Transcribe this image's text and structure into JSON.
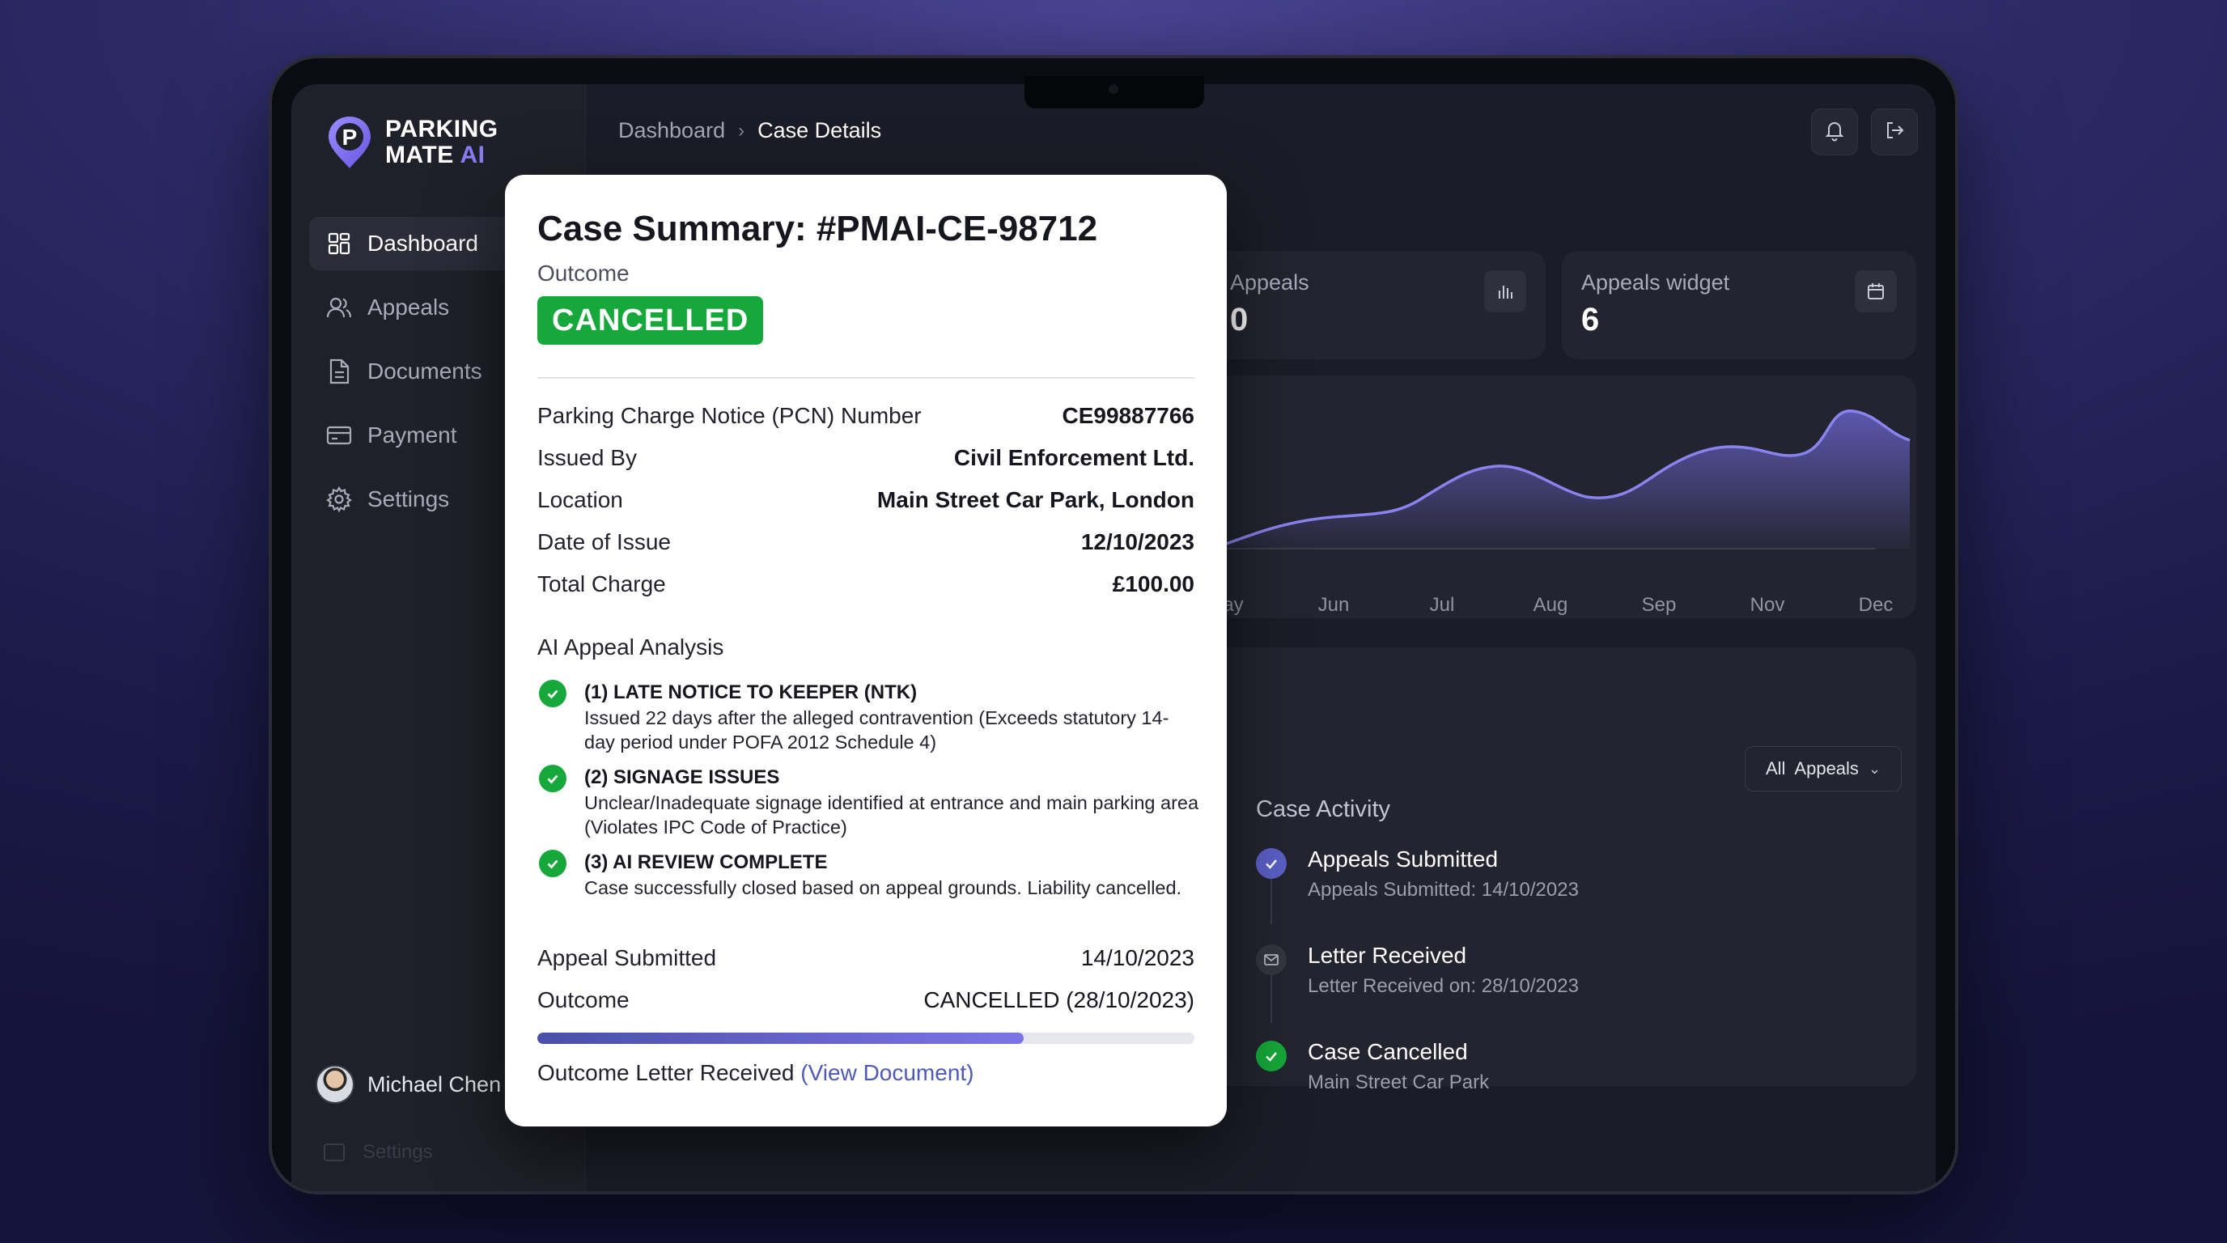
{
  "brand": {
    "line1": "PARKING",
    "line2": "MATE",
    "ai": "AI",
    "accent": "#8b7cf6"
  },
  "sidebar": {
    "items": [
      {
        "label": "Dashboard",
        "icon": "grid-icon",
        "active": true
      },
      {
        "label": "Appeals",
        "icon": "users-icon",
        "active": false
      },
      {
        "label": "Documents",
        "icon": "document-icon",
        "active": false
      },
      {
        "label": "Payment",
        "icon": "credit-card-icon",
        "active": false
      },
      {
        "label": "Settings",
        "icon": "gear-icon",
        "active": false
      }
    ],
    "user": {
      "name": "Michael Chen"
    },
    "ghost_item": "Settings"
  },
  "breadcrumb": {
    "root": "Dashboard",
    "current": "Case Details"
  },
  "topbar": {
    "bell_icon": "bell-icon",
    "logout_icon": "logout-icon"
  },
  "cards": {
    "appeals": {
      "label": "Appeals",
      "value": "0",
      "icon": "bar-chart-icon"
    },
    "widget": {
      "label": "Appeals widget",
      "value": "6",
      "icon": "calendar-icon"
    }
  },
  "chart_data": {
    "type": "area",
    "categories": [
      "May",
      "Jun",
      "Jul",
      "Aug",
      "Sep",
      "Nov",
      "Dec"
    ],
    "color": "#6f68d8"
  },
  "activity": {
    "filter_label": "All  Appeals",
    "title": "Case Activity",
    "items": [
      {
        "title": "Appeals Submitted",
        "sub": "Appeals Submitted: 14/10/2023",
        "icon": "check-icon",
        "color": "#5a5fc7"
      },
      {
        "title": "Letter Received",
        "sub": "Letter Received on: 28/10/2023",
        "icon": "mail-icon",
        "color": "#3a3b48"
      },
      {
        "title": "Case Cancelled",
        "sub": "Main Street Car Park",
        "icon": "check-icon",
        "color": "#16a83a"
      }
    ]
  },
  "modal": {
    "title": "Case Summary: #PMAI-CE-98712",
    "outcome_label": "Outcome",
    "status": "CANCELLED",
    "status_color": "#16a83a",
    "details": [
      {
        "key": "Parking Charge Notice (PCN) Number",
        "value": "CE99887766"
      },
      {
        "key": "Issued By",
        "value": "Civil Enforcement Ltd."
      },
      {
        "key": "Location",
        "value": "Main Street Car Park, London"
      },
      {
        "key": "Date of Issue",
        "value": "12/10/2023"
      },
      {
        "key": "Total Charge",
        "value": "£100.00"
      }
    ],
    "analysis_title": "AI Appeal Analysis",
    "grounds": [
      {
        "title": "(1) LATE NOTICE TO KEEPER (NTK)",
        "desc": "Issued 22 days after the alleged contravention (Exceeds statutory 14-day period under POFA 2012 Schedule 4)"
      },
      {
        "title": "(2) SIGNAGE ISSUES",
        "desc": "Unclear/Inadequate signage identified at entrance and main parking area (Violates IPC Code of Practice)"
      },
      {
        "title": "(3) AI REVIEW COMPLETE",
        "desc": "Case successfully closed based on appeal grounds. Liability cancelled."
      }
    ],
    "appeal_submitted": {
      "key": "Appeal Submitted",
      "value": "14/10/2023"
    },
    "outcome": {
      "key": "Outcome",
      "value": "CANCELLED (28/10/2023)"
    },
    "progress_fraction": 0.74,
    "letter_text": "Outcome Letter Received",
    "letter_link": "(View Document)"
  }
}
